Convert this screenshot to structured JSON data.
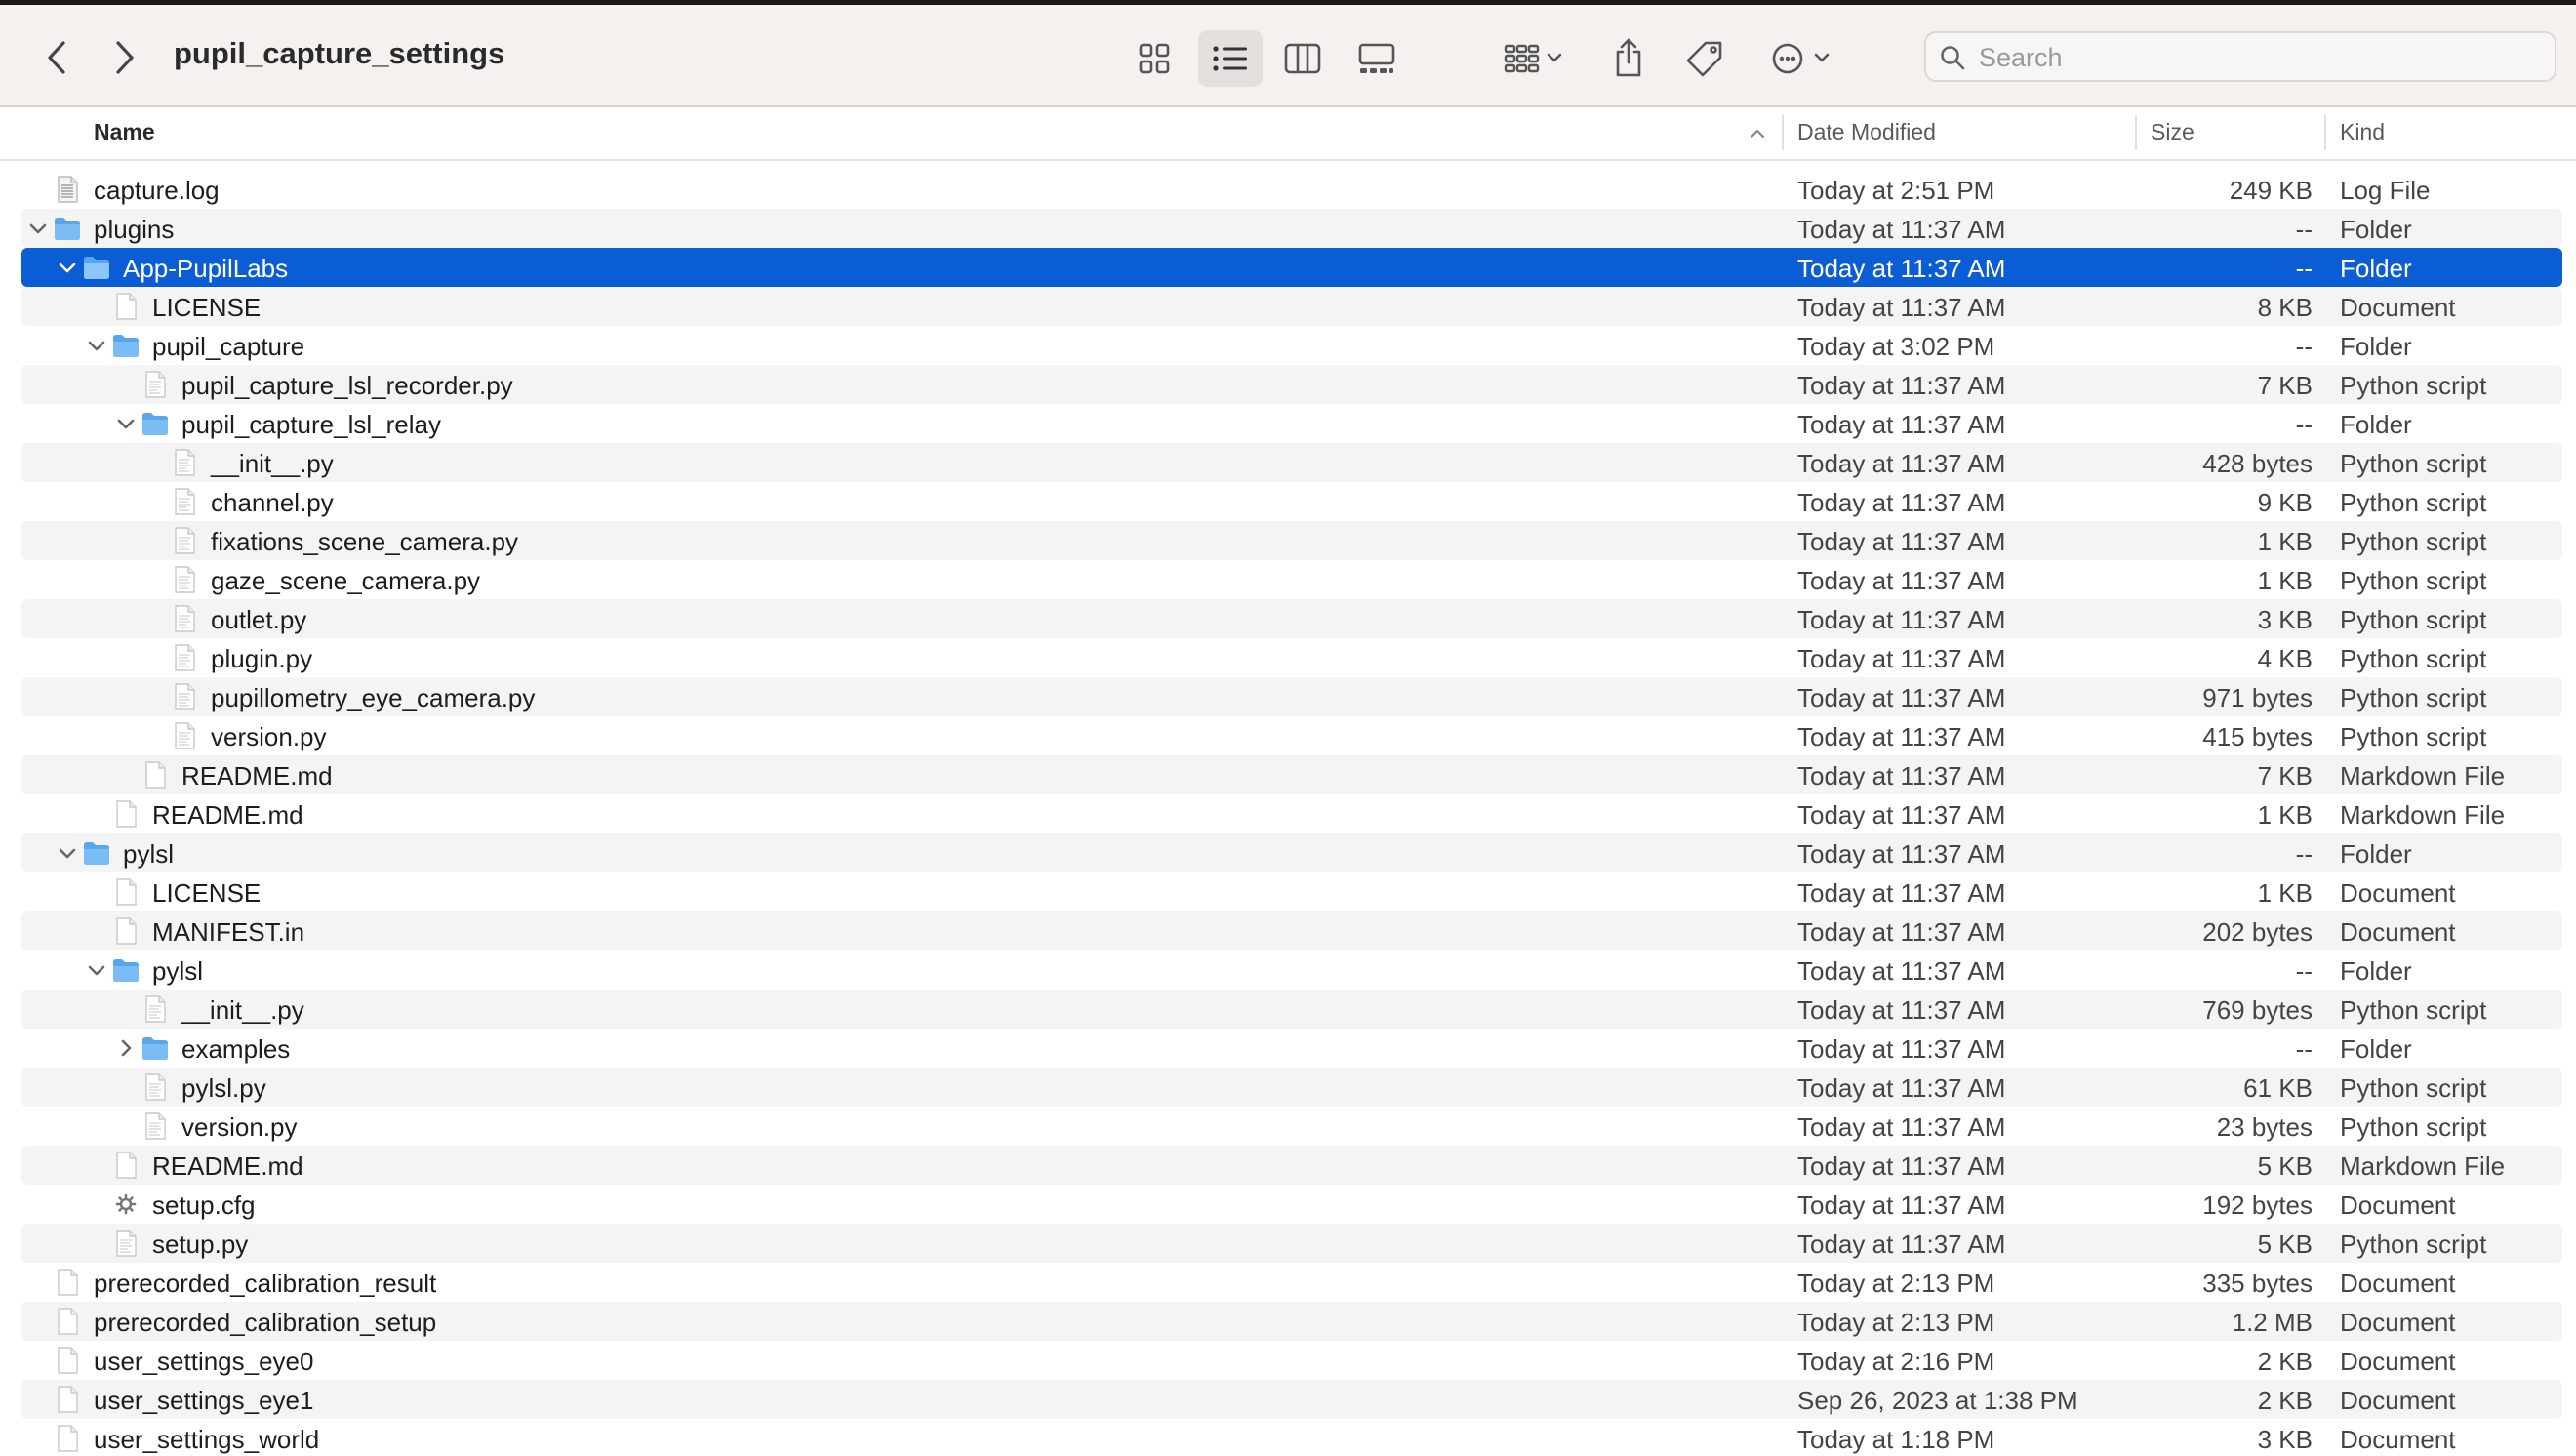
{
  "toolbar": {
    "title": "pupil_capture_settings",
    "search_placeholder": "Search"
  },
  "columns": {
    "name": "Name",
    "date": "Date Modified",
    "size": "Size",
    "kind": "Kind"
  },
  "colors": {
    "selection": "#0a5dd4",
    "folder": "#5aa6ee"
  },
  "rows": [
    {
      "name": "capture.log",
      "date": "Today at 2:51 PM",
      "size": "249 KB",
      "kind": "Log File",
      "depth": 0,
      "type": "log",
      "expand": "none"
    },
    {
      "name": "plugins",
      "date": "Today at 11:37 AM",
      "size": "--",
      "kind": "Folder",
      "depth": 0,
      "type": "folder",
      "expand": "open"
    },
    {
      "name": "App-PupilLabs",
      "date": "Today at 11:37 AM",
      "size": "--",
      "kind": "Folder",
      "depth": 1,
      "type": "folder",
      "expand": "open",
      "selected": true
    },
    {
      "name": "LICENSE",
      "date": "Today at 11:37 AM",
      "size": "8 KB",
      "kind": "Document",
      "depth": 2,
      "type": "doc",
      "expand": "none"
    },
    {
      "name": "pupil_capture",
      "date": "Today at 3:02 PM",
      "size": "--",
      "kind": "Folder",
      "depth": 2,
      "type": "folder",
      "expand": "open"
    },
    {
      "name": "pupil_capture_lsl_recorder.py",
      "date": "Today at 11:37 AM",
      "size": "7 KB",
      "kind": "Python script",
      "depth": 3,
      "type": "script",
      "expand": "none"
    },
    {
      "name": "pupil_capture_lsl_relay",
      "date": "Today at 11:37 AM",
      "size": "--",
      "kind": "Folder",
      "depth": 3,
      "type": "folder",
      "expand": "open"
    },
    {
      "name": "__init__.py",
      "date": "Today at 11:37 AM",
      "size": "428 bytes",
      "kind": "Python script",
      "depth": 4,
      "type": "script",
      "expand": "none"
    },
    {
      "name": "channel.py",
      "date": "Today at 11:37 AM",
      "size": "9 KB",
      "kind": "Python script",
      "depth": 4,
      "type": "script",
      "expand": "none"
    },
    {
      "name": "fixations_scene_camera.py",
      "date": "Today at 11:37 AM",
      "size": "1 KB",
      "kind": "Python script",
      "depth": 4,
      "type": "script",
      "expand": "none"
    },
    {
      "name": "gaze_scene_camera.py",
      "date": "Today at 11:37 AM",
      "size": "1 KB",
      "kind": "Python script",
      "depth": 4,
      "type": "script",
      "expand": "none"
    },
    {
      "name": "outlet.py",
      "date": "Today at 11:37 AM",
      "size": "3 KB",
      "kind": "Python script",
      "depth": 4,
      "type": "script",
      "expand": "none"
    },
    {
      "name": "plugin.py",
      "date": "Today at 11:37 AM",
      "size": "4 KB",
      "kind": "Python script",
      "depth": 4,
      "type": "script",
      "expand": "none"
    },
    {
      "name": "pupillometry_eye_camera.py",
      "date": "Today at 11:37 AM",
      "size": "971 bytes",
      "kind": "Python script",
      "depth": 4,
      "type": "script",
      "expand": "none"
    },
    {
      "name": "version.py",
      "date": "Today at 11:37 AM",
      "size": "415 bytes",
      "kind": "Python script",
      "depth": 4,
      "type": "script",
      "expand": "none"
    },
    {
      "name": "README.md",
      "date": "Today at 11:37 AM",
      "size": "7 KB",
      "kind": "Markdown File",
      "depth": 3,
      "type": "doc",
      "expand": "none"
    },
    {
      "name": "README.md",
      "date": "Today at 11:37 AM",
      "size": "1 KB",
      "kind": "Markdown File",
      "depth": 2,
      "type": "doc",
      "expand": "none"
    },
    {
      "name": "pylsl",
      "date": "Today at 11:37 AM",
      "size": "--",
      "kind": "Folder",
      "depth": 1,
      "type": "folder",
      "expand": "open"
    },
    {
      "name": "LICENSE",
      "date": "Today at 11:37 AM",
      "size": "1 KB",
      "kind": "Document",
      "depth": 2,
      "type": "doc",
      "expand": "none"
    },
    {
      "name": "MANIFEST.in",
      "date": "Today at 11:37 AM",
      "size": "202 bytes",
      "kind": "Document",
      "depth": 2,
      "type": "doc",
      "expand": "none"
    },
    {
      "name": "pylsl",
      "date": "Today at 11:37 AM",
      "size": "--",
      "kind": "Folder",
      "depth": 2,
      "type": "folder",
      "expand": "open"
    },
    {
      "name": "__init__.py",
      "date": "Today at 11:37 AM",
      "size": "769 bytes",
      "kind": "Python script",
      "depth": 3,
      "type": "script",
      "expand": "none"
    },
    {
      "name": "examples",
      "date": "Today at 11:37 AM",
      "size": "--",
      "kind": "Folder",
      "depth": 3,
      "type": "folder",
      "expand": "closed"
    },
    {
      "name": "pylsl.py",
      "date": "Today at 11:37 AM",
      "size": "61 KB",
      "kind": "Python script",
      "depth": 3,
      "type": "script",
      "expand": "none"
    },
    {
      "name": "version.py",
      "date": "Today at 11:37 AM",
      "size": "23 bytes",
      "kind": "Python script",
      "depth": 3,
      "type": "script",
      "expand": "none"
    },
    {
      "name": "README.md",
      "date": "Today at 11:37 AM",
      "size": "5 KB",
      "kind": "Markdown File",
      "depth": 2,
      "type": "doc",
      "expand": "none"
    },
    {
      "name": "setup.cfg",
      "date": "Today at 11:37 AM",
      "size": "192 bytes",
      "kind": "Document",
      "depth": 2,
      "type": "config",
      "expand": "none"
    },
    {
      "name": "setup.py",
      "date": "Today at 11:37 AM",
      "size": "5 KB",
      "kind": "Python script",
      "depth": 2,
      "type": "script",
      "expand": "none"
    },
    {
      "name": "prerecorded_calibration_result",
      "date": "Today at 2:13 PM",
      "size": "335 bytes",
      "kind": "Document",
      "depth": 0,
      "type": "doc",
      "expand": "none"
    },
    {
      "name": "prerecorded_calibration_setup",
      "date": "Today at 2:13 PM",
      "size": "1.2 MB",
      "kind": "Document",
      "depth": 0,
      "type": "doc",
      "expand": "none"
    },
    {
      "name": "user_settings_eye0",
      "date": "Today at 2:16 PM",
      "size": "2 KB",
      "kind": "Document",
      "depth": 0,
      "type": "doc",
      "expand": "none"
    },
    {
      "name": "user_settings_eye1",
      "date": "Sep 26, 2023 at 1:38 PM",
      "size": "2 KB",
      "kind": "Document",
      "depth": 0,
      "type": "doc",
      "expand": "none"
    },
    {
      "name": "user_settings_world",
      "date": "Today at 1:18 PM",
      "size": "3 KB",
      "kind": "Document",
      "depth": 0,
      "type": "doc",
      "expand": "none"
    }
  ]
}
